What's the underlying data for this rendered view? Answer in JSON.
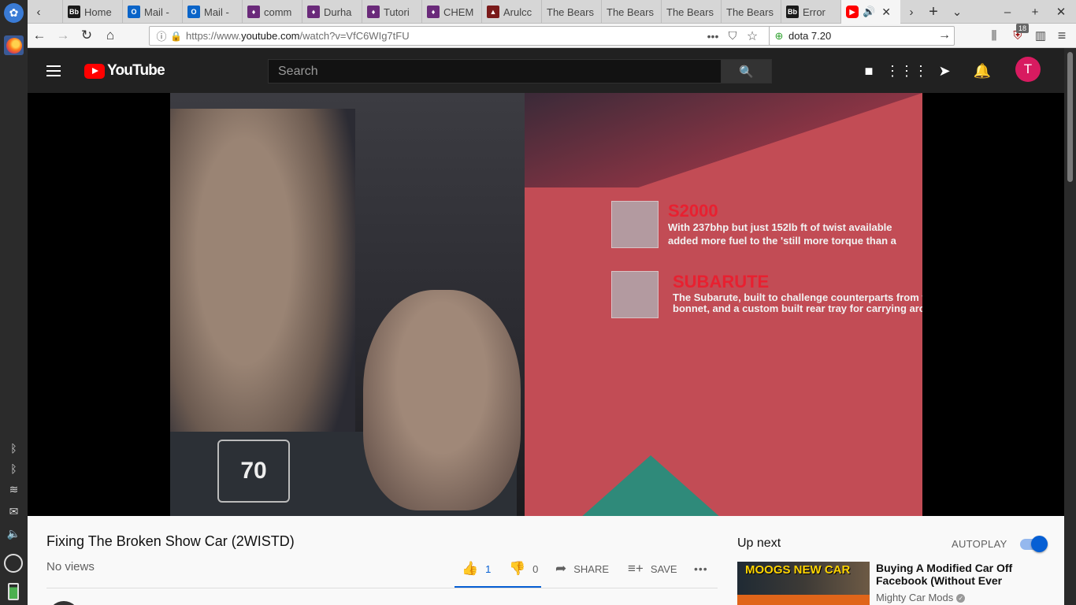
{
  "tabs": [
    {
      "label": "Home",
      "fav_text": "Bb",
      "fav_color": "#1a1a1a"
    },
    {
      "label": "Mail -",
      "fav_text": "O",
      "fav_color": "#0a64c8"
    },
    {
      "label": "Mail -",
      "fav_text": "O",
      "fav_color": "#0a64c8"
    },
    {
      "label": "comm",
      "fav_text": "♦",
      "fav_color": "#6a2a7a"
    },
    {
      "label": "Durha",
      "fav_text": "♦",
      "fav_color": "#6a2a7a"
    },
    {
      "label": "Tutori",
      "fav_text": "♦",
      "fav_color": "#6a2a7a"
    },
    {
      "label": "CHEM",
      "fav_text": "♦",
      "fav_color": "#6a2a7a"
    },
    {
      "label": "Arulcc",
      "fav_text": "▲",
      "fav_color": "#7a1a1a"
    },
    {
      "label": "The Bears",
      "fav_text": "",
      "fav_color": ""
    },
    {
      "label": "The Bears",
      "fav_text": "",
      "fav_color": ""
    },
    {
      "label": "The Bears",
      "fav_text": "",
      "fav_color": ""
    },
    {
      "label": "The Bears",
      "fav_text": "",
      "fav_color": ""
    },
    {
      "label": "Error",
      "fav_text": "Bb",
      "fav_color": "#1a1a1a"
    }
  ],
  "browser": {
    "url_prefix": "https://www.",
    "url_domain": "youtube.com",
    "url_path": "/watch?v=VfC6WIg7tFU",
    "search_value": "dota 7.20",
    "badge_count": "18"
  },
  "youtube": {
    "logo_text": "YouTube",
    "search_placeholder": "Search",
    "avatar_letter": "T"
  },
  "video_overlay": {
    "card1_title": "S2000",
    "card1_line1": "With 237bhp but just 152lb ft of twist available",
    "card1_line2": "added more fuel to the 'still more torque than a",
    "card2_title": "SUBARUTE",
    "card2_line1": "The Subarute, built to challenge counterparts from fa",
    "card2_line2": "bonnet, and a custom built rear tray for carrying arou",
    "shirt_text": "70"
  },
  "video": {
    "title": "Fixing The Broken Show Car (2WISTD)",
    "views": "No views",
    "likes": "1",
    "dislikes": "0",
    "share_label": "SHARE",
    "save_label": "SAVE",
    "more_label": "•••"
  },
  "sidebar": {
    "upnext_label": "Up next",
    "autoplay_label": "AUTOPLAY",
    "autoplay_on": true,
    "thumb_text": "MOOGS NEW CAR",
    "next_title": "Buying A Modified Car Off Facebook (Without Ever",
    "next_channel": "Mighty Car Mods"
  },
  "colors": {
    "yt_red": "#ff0000",
    "accent_blue": "#065fd4",
    "avatar_pink": "#d81b60"
  }
}
